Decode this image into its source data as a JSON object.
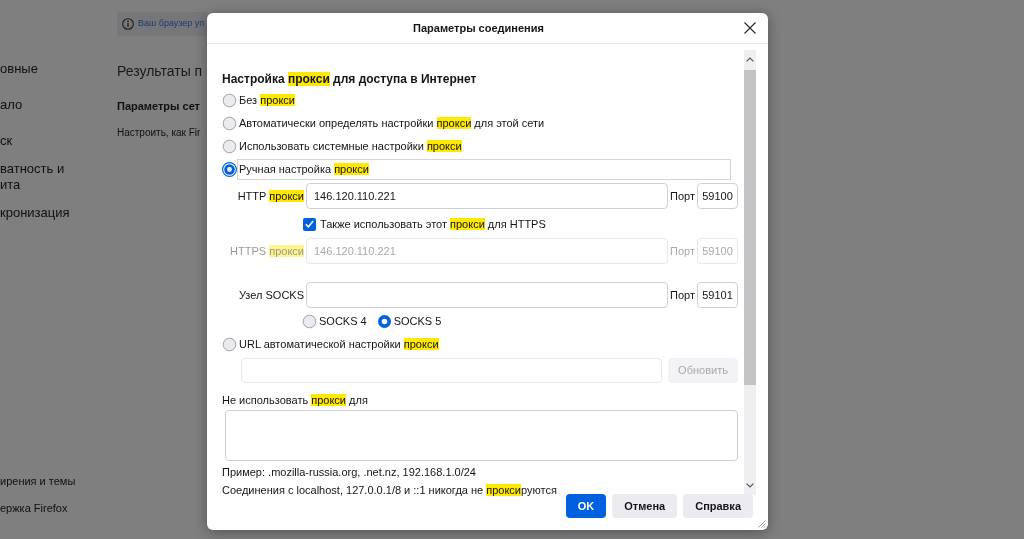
{
  "background_page": {
    "sidebar_items": [
      "овные",
      "ало",
      "ск",
      "ватность и\nита",
      "кронизация"
    ],
    "sidebar_footer_items": [
      "ирения и темы",
      "ержка Firefox"
    ],
    "notice": "Ваш браузер уп",
    "heading": "Результаты п",
    "section_title": "Параметры сет",
    "section_text": "Настроить, как Fir"
  },
  "dialog": {
    "title": "Параметры соединения",
    "heading": [
      {
        "text": "Настройка ",
        "highlighted": false
      },
      {
        "text": "прокси",
        "highlighted": true
      },
      {
        "text": " для доступа в Интернет",
        "highlighted": false
      }
    ],
    "proxy_modes": [
      {
        "kind": "plain",
        "label": [
          {
            "text": "Без ",
            "highlighted": false
          },
          {
            "text": "прокси",
            "highlighted": true
          }
        ],
        "selected": false,
        "focused": false
      },
      {
        "kind": "plain",
        "label": [
          {
            "text": "Автоматически определять настройки ",
            "highlighted": false
          },
          {
            "text": "прокси",
            "highlighted": true
          },
          {
            "text": " для этой сети",
            "highlighted": false
          }
        ],
        "selected": false,
        "focused": false
      },
      {
        "kind": "plain",
        "label": [
          {
            "text": "Использовать системные настройки ",
            "highlighted": false
          },
          {
            "text": "прокси",
            "highlighted": true
          }
        ],
        "selected": false,
        "focused": false
      },
      {
        "kind": "manual",
        "label": [
          {
            "text": "Ручная настройка ",
            "highlighted": false
          },
          {
            "text": "прокси",
            "highlighted": true
          }
        ],
        "selected": true,
        "focused": true,
        "rows": [
          {
            "kind": "proxy",
            "label": [
              {
                "text": "HTTP ",
                "highlighted": false
              },
              {
                "text": "прокси",
                "highlighted": true
              }
            ],
            "value": "146.120.110.221",
            "port_label": "Порт",
            "port": "59100",
            "disabled": false
          },
          {
            "kind": "checkbox",
            "label": [
              {
                "text": "Также использовать этот ",
                "highlighted": false
              },
              {
                "text": "прокси",
                "highlighted": true
              },
              {
                "text": " для HTTPS",
                "highlighted": false
              }
            ],
            "checked": true
          },
          {
            "kind": "proxy",
            "label": [
              {
                "text": "HTTPS ",
                "highlighted": false
              },
              {
                "text": "прокси",
                "highlighted": true
              }
            ],
            "value": "146.120.110.221",
            "port_label": "Порт",
            "port": "59100",
            "disabled": true
          },
          {
            "kind": "proxy",
            "label": [
              {
                "text": "Узел SOCKS",
                "highlighted": false
              }
            ],
            "port_label": "Порт",
            "port": "59101",
            "disabled": false
          },
          {
            "kind": "radios",
            "options": [
              {
                "label": "SOCKS 4",
                "selected": false
              },
              {
                "label": "SOCKS 5",
                "selected": true
              }
            ]
          }
        ]
      },
      {
        "kind": "url",
        "label": [
          {
            "text": "URL автоматической настройки ",
            "highlighted": false
          },
          {
            "text": "прокси",
            "highlighted": true
          }
        ],
        "selected": false,
        "focused": false,
        "reload_button": {
          "label": "Обновить",
          "disabled": true
        }
      }
    ],
    "no_proxy": {
      "label": [
        {
          "text": "Не использовать ",
          "highlighted": false
        },
        {
          "text": "прокси",
          "highlighted": true
        },
        {
          "text": " для",
          "highlighted": false
        }
      ],
      "hint": "Пример: .mozilla-russia.org, .net.nz, 192.168.1.0/24",
      "note": [
        {
          "text": "Соединения с localhost, 127.0.0.1/8 и ::1 никогда не ",
          "highlighted": false
        },
        {
          "text": "прокси",
          "highlighted": true
        },
        {
          "text": "руются",
          "highlighted": false
        }
      ]
    },
    "buttons": [
      {
        "label": "OK",
        "kind": "primary"
      },
      {
        "label": "Отмена",
        "kind": "secondary"
      },
      {
        "label": "Справка",
        "kind": "secondary"
      }
    ]
  }
}
